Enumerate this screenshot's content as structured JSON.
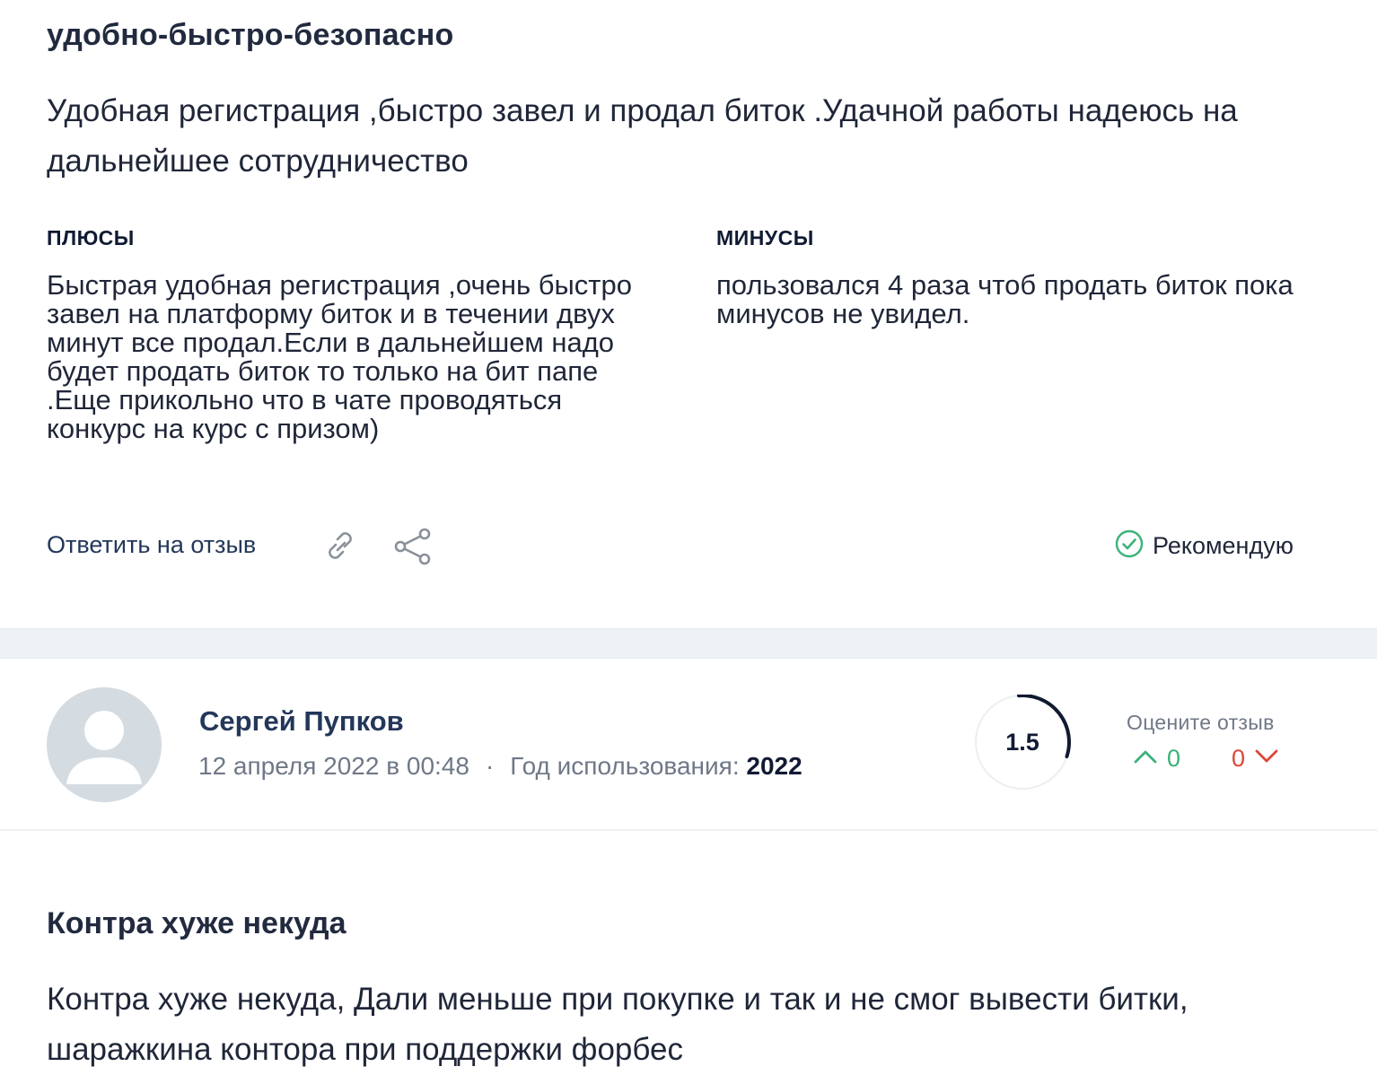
{
  "review1": {
    "title": "удобно-быстро-безопасно",
    "body": "Удобная регистрация ,быстро завел и продал биток .Удачной работы надеюсь на дальнейшее сотрудничество",
    "plus_heading": "ПЛЮСЫ",
    "plus_text": "Быстрая удобная регистрация ,очень быстро завел на платформу биток и в течении двух минут все продал.Если в дальнейшем надо будет продать биток то только на бит папе .Еще прикольно что в чате проводяться конкурс на курс с призом)",
    "minus_heading": "МИНУСЫ",
    "minus_text": "пользовался 4 раза чтоб продать биток пока минусов не увидел.",
    "reply_label": "Ответить на отзыв",
    "link_icon": "link-icon",
    "share_icon": "share-icon",
    "recommend_label": "Рекомендую",
    "recommend_color": "#3bb27a"
  },
  "review2": {
    "author": "Сергей Пупков",
    "date": "12 апреля 2022 в 00:48",
    "separator": "·",
    "usage_label": "Год использования:",
    "usage_year": "2022",
    "score": "1.5",
    "score_fraction": 0.3,
    "rate_label": "Оцените отзыв",
    "upvotes": "0",
    "downvotes": "0",
    "up_color": "#3bb27a",
    "down_color": "#e0443a",
    "title": "Контра хуже некуда",
    "body": "Контра хуже некуда, Дали меньше при покупке и так и не смог вывести битки, шаражкина контора при поддержки форбес"
  }
}
